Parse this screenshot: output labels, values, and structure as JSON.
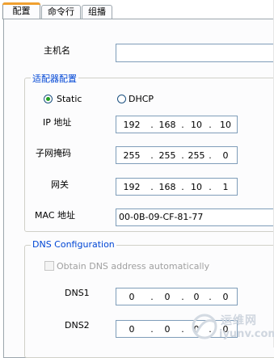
{
  "tabs": [
    {
      "label": "配置",
      "active": true
    },
    {
      "label": "命令行",
      "active": false
    },
    {
      "label": "组播",
      "active": false
    }
  ],
  "hostname": {
    "label": "主机名",
    "value": ""
  },
  "adapter": {
    "title": "适配器配置",
    "static_label": "Static",
    "dhcp_label": "DHCP",
    "selected": "Static",
    "ip": {
      "label": "IP 地址",
      "octets": [
        "192",
        "168",
        "10",
        "10"
      ]
    },
    "mask": {
      "label": "子网掩码",
      "octets": [
        "255",
        "255",
        "255",
        "0"
      ]
    },
    "gateway": {
      "label": "网关",
      "octets": [
        "192",
        "168",
        "10",
        "1"
      ]
    },
    "mac": {
      "label": "MAC 地址",
      "value": "00-0B-09-CF-81-77"
    }
  },
  "dns": {
    "title": "DNS Configuration",
    "auto_label": "Obtain DNS address automatically",
    "auto_checked": false,
    "auto_enabled": false,
    "dns1": {
      "label": "DNS1",
      "octets": [
        "0",
        "0",
        "0",
        "0"
      ]
    },
    "dns2": {
      "label": "DNS2",
      "octets": [
        "0",
        "0",
        "0",
        "0"
      ]
    }
  },
  "watermark": {
    "line1": "运维网",
    "line2": "iyunv.com"
  },
  "colors": {
    "accent_tab": "#f0a030",
    "group_title": "#0046d5",
    "radio_dot": "#21a121",
    "field_border": "#7f9db9"
  }
}
